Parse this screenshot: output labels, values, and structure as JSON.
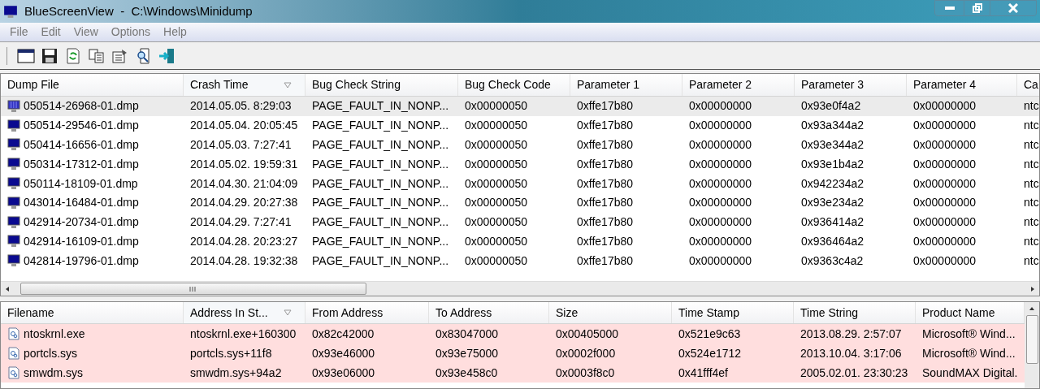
{
  "window": {
    "title": "BlueScreenView  -  C:\\Windows\\Minidump"
  },
  "menu": [
    "File",
    "Edit",
    "View",
    "Options",
    "Help"
  ],
  "dumps": {
    "columns": [
      {
        "label": "Dump File",
        "sorted": false
      },
      {
        "label": "Crash Time",
        "sorted": true
      },
      {
        "label": "Bug Check String",
        "sorted": false
      },
      {
        "label": "Bug Check Code",
        "sorted": false
      },
      {
        "label": "Parameter 1",
        "sorted": false
      },
      {
        "label": "Parameter 2",
        "sorted": false
      },
      {
        "label": "Parameter 3",
        "sorted": false
      },
      {
        "label": "Parameter 4",
        "sorted": false
      },
      {
        "label": "Ca",
        "sorted": false
      }
    ],
    "rows": [
      {
        "selected": true,
        "cells": [
          "050514-26968-01.dmp",
          "2014.05.05. 8:29:03",
          "PAGE_FAULT_IN_NONP...",
          "0x00000050",
          "0xffe17b80",
          "0x00000000",
          "0x93e0f4a2",
          "0x00000000",
          "ntc"
        ]
      },
      {
        "selected": false,
        "cells": [
          "050514-29546-01.dmp",
          "2014.05.04. 20:05:45",
          "PAGE_FAULT_IN_NONP...",
          "0x00000050",
          "0xffe17b80",
          "0x00000000",
          "0x93a344a2",
          "0x00000000",
          "ntc"
        ]
      },
      {
        "selected": false,
        "cells": [
          "050414-16656-01.dmp",
          "2014.05.03. 7:27:41",
          "PAGE_FAULT_IN_NONP...",
          "0x00000050",
          "0xffe17b80",
          "0x00000000",
          "0x93e344a2",
          "0x00000000",
          "ntc"
        ]
      },
      {
        "selected": false,
        "cells": [
          "050314-17312-01.dmp",
          "2014.05.02. 19:59:31",
          "PAGE_FAULT_IN_NONP...",
          "0x00000050",
          "0xffe17b80",
          "0x00000000",
          "0x93e1b4a2",
          "0x00000000",
          "ntc"
        ]
      },
      {
        "selected": false,
        "cells": [
          "050114-18109-01.dmp",
          "2014.04.30. 21:04:09",
          "PAGE_FAULT_IN_NONP...",
          "0x00000050",
          "0xffe17b80",
          "0x00000000",
          "0x942234a2",
          "0x00000000",
          "ntc"
        ]
      },
      {
        "selected": false,
        "cells": [
          "043014-16484-01.dmp",
          "2014.04.29. 20:27:38",
          "PAGE_FAULT_IN_NONP...",
          "0x00000050",
          "0xffe17b80",
          "0x00000000",
          "0x93e234a2",
          "0x00000000",
          "ntc"
        ]
      },
      {
        "selected": false,
        "cells": [
          "042914-20734-01.dmp",
          "2014.04.29. 7:27:41",
          "PAGE_FAULT_IN_NONP...",
          "0x00000050",
          "0xffe17b80",
          "0x00000000",
          "0x936414a2",
          "0x00000000",
          "ntc"
        ]
      },
      {
        "selected": false,
        "cells": [
          "042914-16109-01.dmp",
          "2014.04.28. 20:23:27",
          "PAGE_FAULT_IN_NONP...",
          "0x00000050",
          "0xffe17b80",
          "0x00000000",
          "0x936464a2",
          "0x00000000",
          "ntc"
        ]
      },
      {
        "selected": false,
        "cells": [
          "042814-19796-01.dmp",
          "2014.04.28. 19:32:38",
          "PAGE_FAULT_IN_NONP...",
          "0x00000050",
          "0xffe17b80",
          "0x00000000",
          "0x9363c4a2",
          "0x00000000",
          "ntc"
        ]
      }
    ]
  },
  "drivers": {
    "columns": [
      {
        "label": "Filename",
        "sorted": false
      },
      {
        "label": "Address In St...",
        "sorted": true
      },
      {
        "label": "From Address",
        "sorted": false
      },
      {
        "label": "To Address",
        "sorted": false
      },
      {
        "label": "Size",
        "sorted": false
      },
      {
        "label": "Time Stamp",
        "sorted": false
      },
      {
        "label": "Time String",
        "sorted": false
      },
      {
        "label": "Product Name",
        "sorted": false
      }
    ],
    "rows": [
      {
        "highlighted": true,
        "cells": [
          "ntoskrnl.exe",
          "ntoskrnl.exe+160300",
          "0x82c42000",
          "0x83047000",
          "0x00405000",
          "0x521e9c63",
          "2013.08.29. 2:57:07",
          "Microsoft® Wind..."
        ]
      },
      {
        "highlighted": true,
        "cells": [
          "portcls.sys",
          "portcls.sys+11f8",
          "0x93e46000",
          "0x93e75000",
          "0x0002f000",
          "0x524e1712",
          "2013.10.04. 3:17:06",
          "Microsoft® Wind..."
        ]
      },
      {
        "highlighted": true,
        "cells": [
          "smwdm.sys",
          "smwdm.sys+94a2",
          "0x93e06000",
          "0x93e458c0",
          "0x0003f8c0",
          "0x41fff4ef",
          "2005.02.01. 23:30:23",
          "SoundMAX Digital."
        ]
      }
    ]
  }
}
